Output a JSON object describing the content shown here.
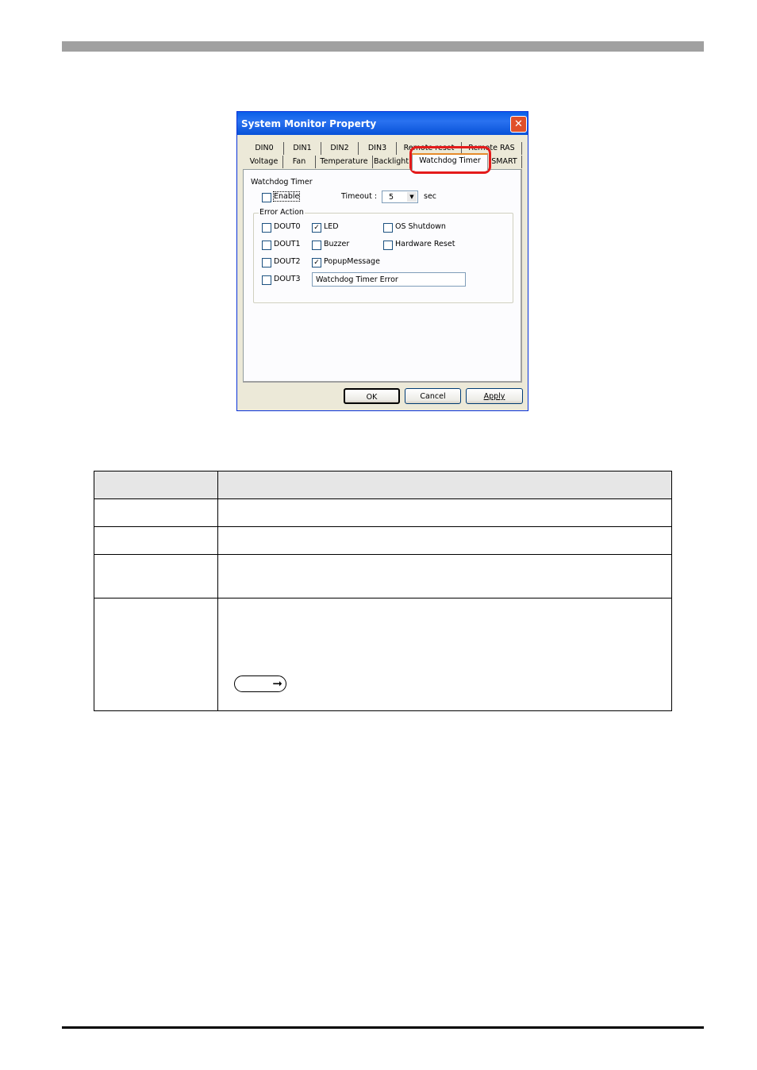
{
  "dialog": {
    "title": "System Monitor Property",
    "tabs_row1": [
      "DIN0",
      "DIN1",
      "DIN2",
      "DIN3",
      "Remote reset",
      "Remote RAS"
    ],
    "tabs_row2": [
      "Voltage",
      "Fan",
      "Temperature",
      "Backlight",
      "Watchdog Timer",
      "SMART"
    ],
    "active_tab": "Watchdog Timer",
    "section_label": "Watchdog Timer",
    "enable": {
      "label": "Enable",
      "checked": false
    },
    "timeout": {
      "label": "Timeout :",
      "value": "5",
      "unit": "sec"
    },
    "error_action": {
      "label": "Error Action",
      "items": [
        {
          "label": "DOUT0",
          "checked": false
        },
        {
          "label": "LED",
          "checked": true
        },
        {
          "label": "OS Shutdown",
          "checked": false
        },
        {
          "label": "DOUT1",
          "checked": false
        },
        {
          "label": "Buzzer",
          "checked": false
        },
        {
          "label": "Hardware Reset",
          "checked": false
        },
        {
          "label": "DOUT2",
          "checked": false
        },
        {
          "label": "PopupMessage",
          "checked": true
        },
        {
          "label": "DOUT3",
          "checked": false
        }
      ],
      "popup_message_text": "Watchdog Timer Error"
    },
    "buttons": {
      "ok": "OK",
      "cancel": "Cancel",
      "apply": "Apply"
    },
    "highlight_color": "#e41b1b"
  }
}
